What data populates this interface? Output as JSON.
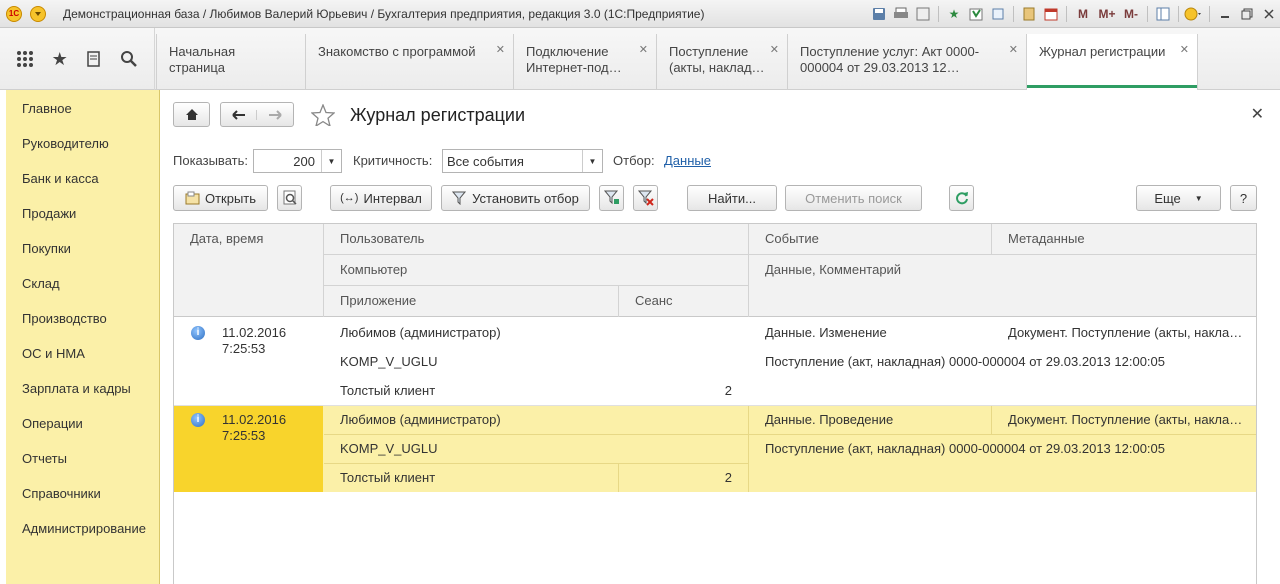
{
  "window": {
    "title": "Демонстрационная база / Любимов Валерий Юрьевич / Бухгалтерия предприятия, редакция 3.0  (1С:Предприятие)",
    "logo_text": "1С",
    "toolbar_m": "M",
    "toolbar_mplus": "M+",
    "toolbar_mminus": "M-"
  },
  "tabs": [
    {
      "label": "Начальная страница",
      "closable": false
    },
    {
      "label": "Знакомство с программой",
      "closable": true
    },
    {
      "label": "Подключение Интернет-под…",
      "closable": true
    },
    {
      "label": "Поступление (акты, наклад…",
      "closable": true
    },
    {
      "label": "Поступление услуг: Акт 0000-000004 от 29.03.2013 12…",
      "closable": true
    },
    {
      "label": "Журнал регистрации",
      "closable": true,
      "active": true
    }
  ],
  "sidebar": {
    "items": [
      "Главное",
      "Руководителю",
      "Банк и касса",
      "Продажи",
      "Покупки",
      "Склад",
      "Производство",
      "ОС и НМА",
      "Зарплата и кадры",
      "Операции",
      "Отчеты",
      "Справочники",
      "Администрирование"
    ]
  },
  "page": {
    "title": "Журнал регистрации",
    "show_label": "Показывать:",
    "show_value": "200",
    "severity_label": "Критичность:",
    "severity_value": "Все события",
    "filter_label": "Отбор:",
    "filter_link": "Данные"
  },
  "toolbar": {
    "open": "Открыть",
    "interval": "Интервал",
    "set_filter": "Установить отбор",
    "find": "Найти...",
    "cancel_search": "Отменить поиск",
    "more": "Еще",
    "help": "?"
  },
  "grid": {
    "headers": {
      "datetime": "Дата, время",
      "user": "Пользователь",
      "event": "Событие",
      "metadata": "Метаданные",
      "computer": "Компьютер",
      "data_comment": "Данные, Комментарий",
      "application": "Приложение",
      "session": "Сеанс"
    },
    "rows": [
      {
        "date": "11.02.2016",
        "time": "7:25:53",
        "user": "Любимов (администратор)",
        "event": "Данные. Изменение",
        "metadata": "Документ. Поступление (акты, накла…",
        "computer": "KOMP_V_UGLU",
        "data": "Поступление (акт, накладная) 0000-000004 от 29.03.2013 12:00:05",
        "application": "Толстый клиент",
        "session": "2"
      },
      {
        "date": "11.02.2016",
        "time": "7:25:53",
        "user": "Любимов (администратор)",
        "event": "Данные. Проведение",
        "metadata": "Документ. Поступление (акты, накла…",
        "computer": "KOMP_V_UGLU",
        "data": "Поступление (акт, накладная) 0000-000004 от 29.03.2013 12:00:05",
        "application": "Толстый клиент",
        "session": "2",
        "selected": true
      }
    ]
  }
}
